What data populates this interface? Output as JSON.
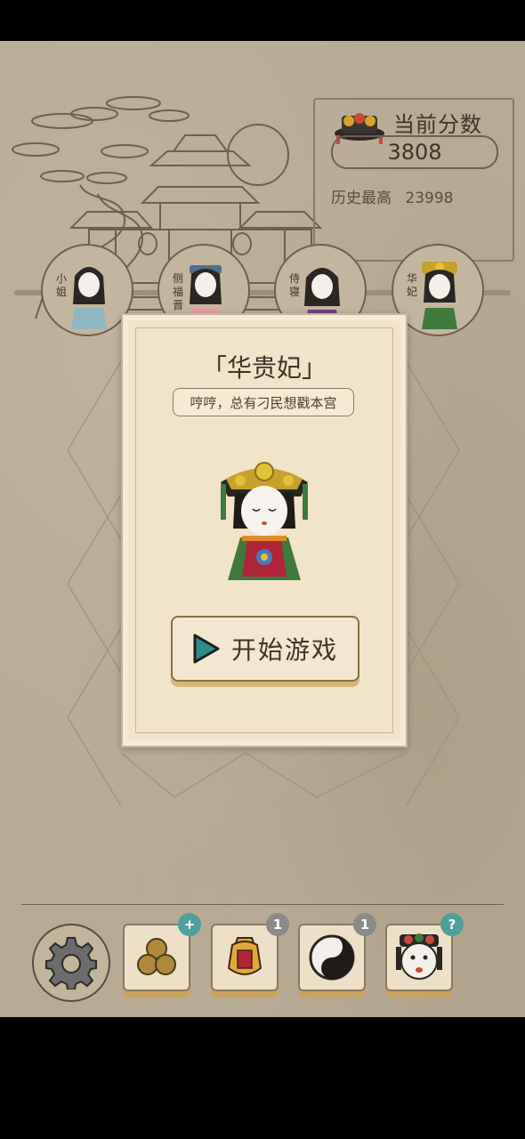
{
  "score": {
    "title": "当前分数",
    "current": "3808",
    "best_label": "历史最高",
    "best_value": "23998"
  },
  "characters": [
    {
      "label": "小姐",
      "color": "#8fb7c2"
    },
    {
      "label": "侧福晋",
      "color": "#e2a0a6"
    },
    {
      "label": "侍寝",
      "color": "#7a3e7e"
    },
    {
      "label": "华妃",
      "color": "#c8a02a"
    }
  ],
  "dialog": {
    "title": "「华贵妃」",
    "subtitle": "哼哼，总有刁民想戳本宫",
    "start_label": "开始游戏"
  },
  "toolbar": {
    "items": [
      {
        "icon": "coins-icon",
        "badge": "+"
      },
      {
        "icon": "jar-icon",
        "badge": "1"
      },
      {
        "icon": "yinyang-icon",
        "badge": "1"
      },
      {
        "icon": "emperor-icon",
        "badge": "?"
      }
    ]
  },
  "colors": {
    "accent": "#4f9f9a",
    "play": "#2a8f8a",
    "paper": "#f2e4c9"
  }
}
